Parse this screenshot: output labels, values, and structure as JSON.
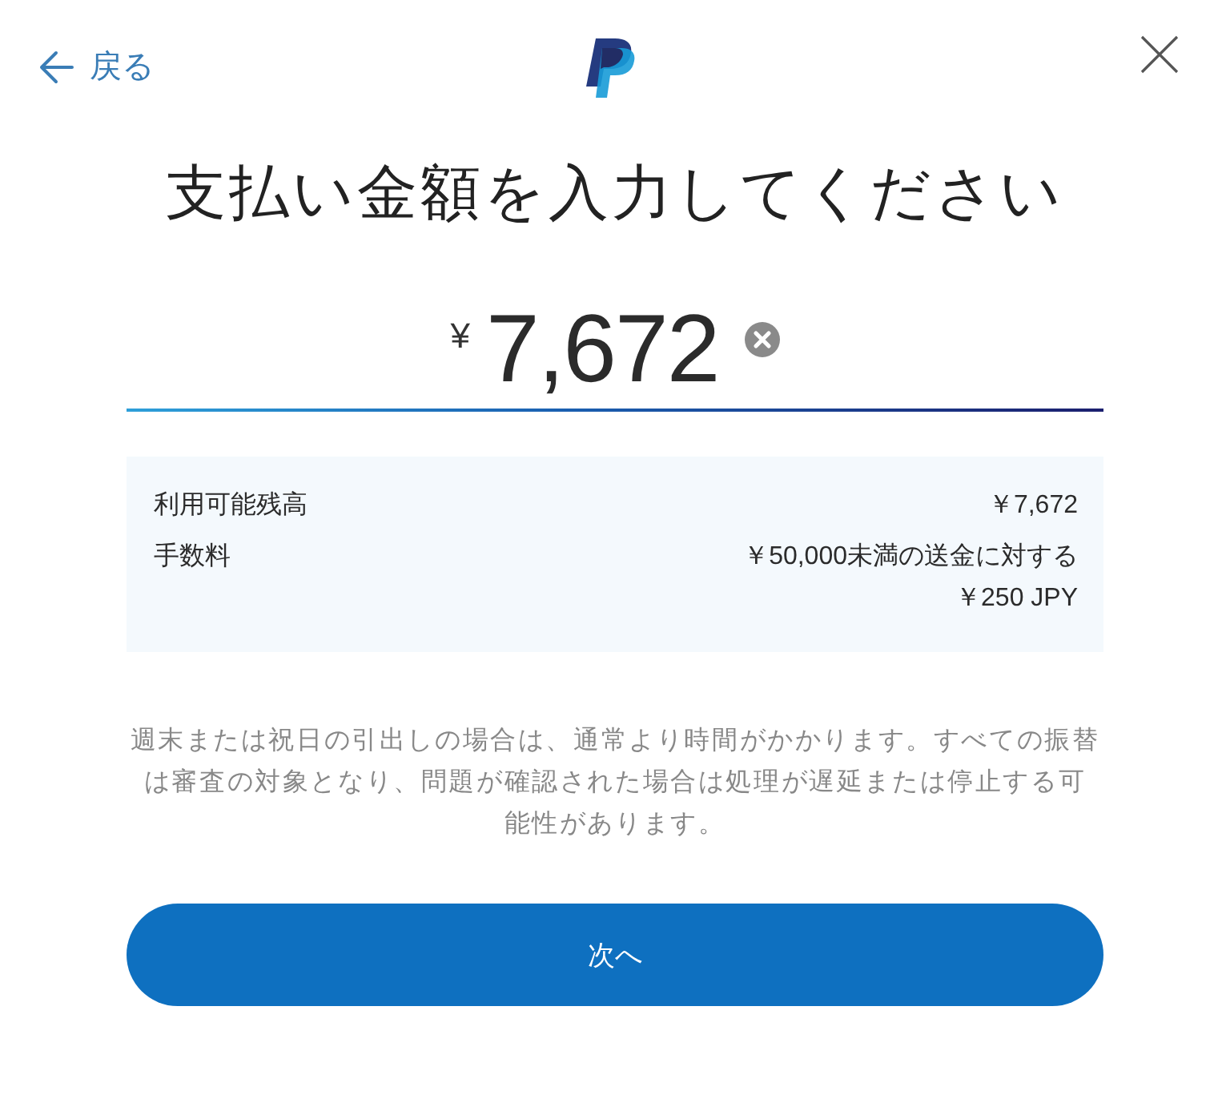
{
  "header": {
    "back_label": "戻る"
  },
  "title": "支払い金額を入力してください",
  "amount": {
    "currency": "¥",
    "value": "7,672"
  },
  "summary": [
    {
      "label": "利用可能残高",
      "lines": [
        "￥7,672"
      ]
    },
    {
      "label": "手数料",
      "lines": [
        "￥50,000未満の送金に対する",
        "￥250 JPY"
      ]
    }
  ],
  "notice_lines": [
    "週末または祝日の引出しの場合は、通常より時間がかかります。すべての振替",
    "は審査の対象となり、問題が確認された場合は処理が遅延または停止する可",
    "能性があります。"
  ],
  "primary_button": "次へ"
}
